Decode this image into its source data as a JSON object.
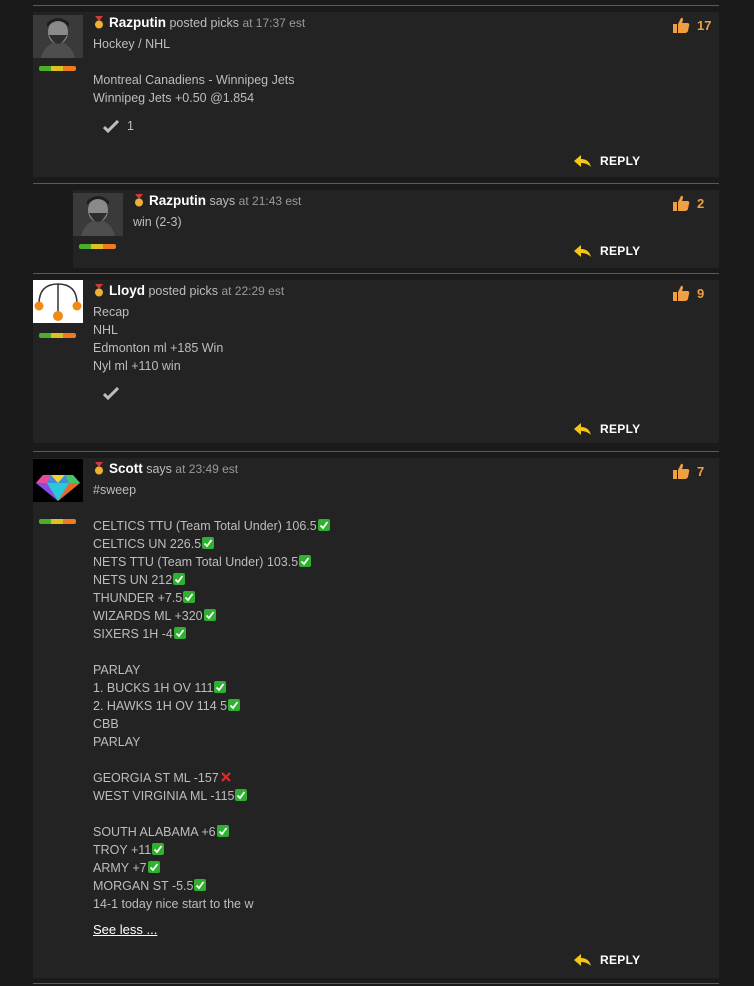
{
  "comments": [
    {
      "username": "Razputin",
      "verb": "posted picks",
      "time": "at 17:37 est",
      "likes": "17",
      "lines": [
        "Hockey / NHL",
        "",
        "Montreal Canadiens - Winnipeg Jets",
        "Winnipeg Jets +0.50 @1.854"
      ],
      "tail_votes": "1",
      "reply_label": "REPLY"
    },
    {
      "username": "Razputin",
      "verb": "says",
      "time": "at 21:43 est",
      "likes": "2",
      "lines": [
        "win (2-3)"
      ],
      "reply_label": "REPLY"
    },
    {
      "username": "Lloyd",
      "verb": "posted picks",
      "time": "at 22:29 est",
      "likes": "9",
      "lines": [
        "Recap",
        "NHL",
        "Edmonton ml +185 Win",
        "Nyl ml +110 win"
      ],
      "reply_label": "REPLY"
    },
    {
      "username": "Scott",
      "verb": "says",
      "time": "at 23:49 est",
      "likes": "7",
      "lines": [
        {
          "t": "#sweep",
          "m": ""
        },
        {
          "t": "",
          "m": ""
        },
        {
          "t": "CELTICS TTU (Team Total Under) 106.5",
          "m": "check"
        },
        {
          "t": "CELTICS UN 226.5",
          "m": "check"
        },
        {
          "t": "NETS TTU (Team Total Under) 103.5",
          "m": "check"
        },
        {
          "t": "NETS UN 212",
          "m": "check"
        },
        {
          "t": "THUNDER +7.5",
          "m": "check"
        },
        {
          "t": "WIZARDS ML +320",
          "m": "check"
        },
        {
          "t": "SIXERS 1H -4",
          "m": "check"
        },
        {
          "t": "",
          "m": ""
        },
        {
          "t": "PARLAY",
          "m": ""
        },
        {
          "t": "1. BUCKS 1H OV 111",
          "m": "check"
        },
        {
          "t": "2. HAWKS 1H OV 114 5",
          "m": "check"
        },
        {
          "t": "CBB",
          "m": ""
        },
        {
          "t": "PARLAY",
          "m": ""
        },
        {
          "t": "",
          "m": ""
        },
        {
          "t": "GEORGIA ST ML -157",
          "m": "cross"
        },
        {
          "t": "WEST VIRGINIA ML -115",
          "m": "check"
        },
        {
          "t": "",
          "m": ""
        },
        {
          "t": "SOUTH ALABAMA +6",
          "m": "check"
        },
        {
          "t": "TROY +11",
          "m": "check"
        },
        {
          "t": "ARMY +7",
          "m": "check"
        },
        {
          "t": "MORGAN ST -5.5",
          "m": "check"
        },
        {
          "t": "14-1 today nice start to the w",
          "m": ""
        }
      ],
      "see_less": "See less ...",
      "reply_label": "REPLY"
    }
  ],
  "colors": {
    "background": "#1a1a1a",
    "panel": "#232323",
    "like_count": "#f0a040",
    "check": "#2fb02f",
    "cross": "#e02a2a"
  },
  "icons": {
    "like": "thumbs-up-icon",
    "reply": "reply-arrow-icon",
    "medal": "medal-icon",
    "vote": "checkmark-icon",
    "check": "check-mark-icon",
    "cross": "cross-mark-icon"
  },
  "rating_level": 0.4
}
